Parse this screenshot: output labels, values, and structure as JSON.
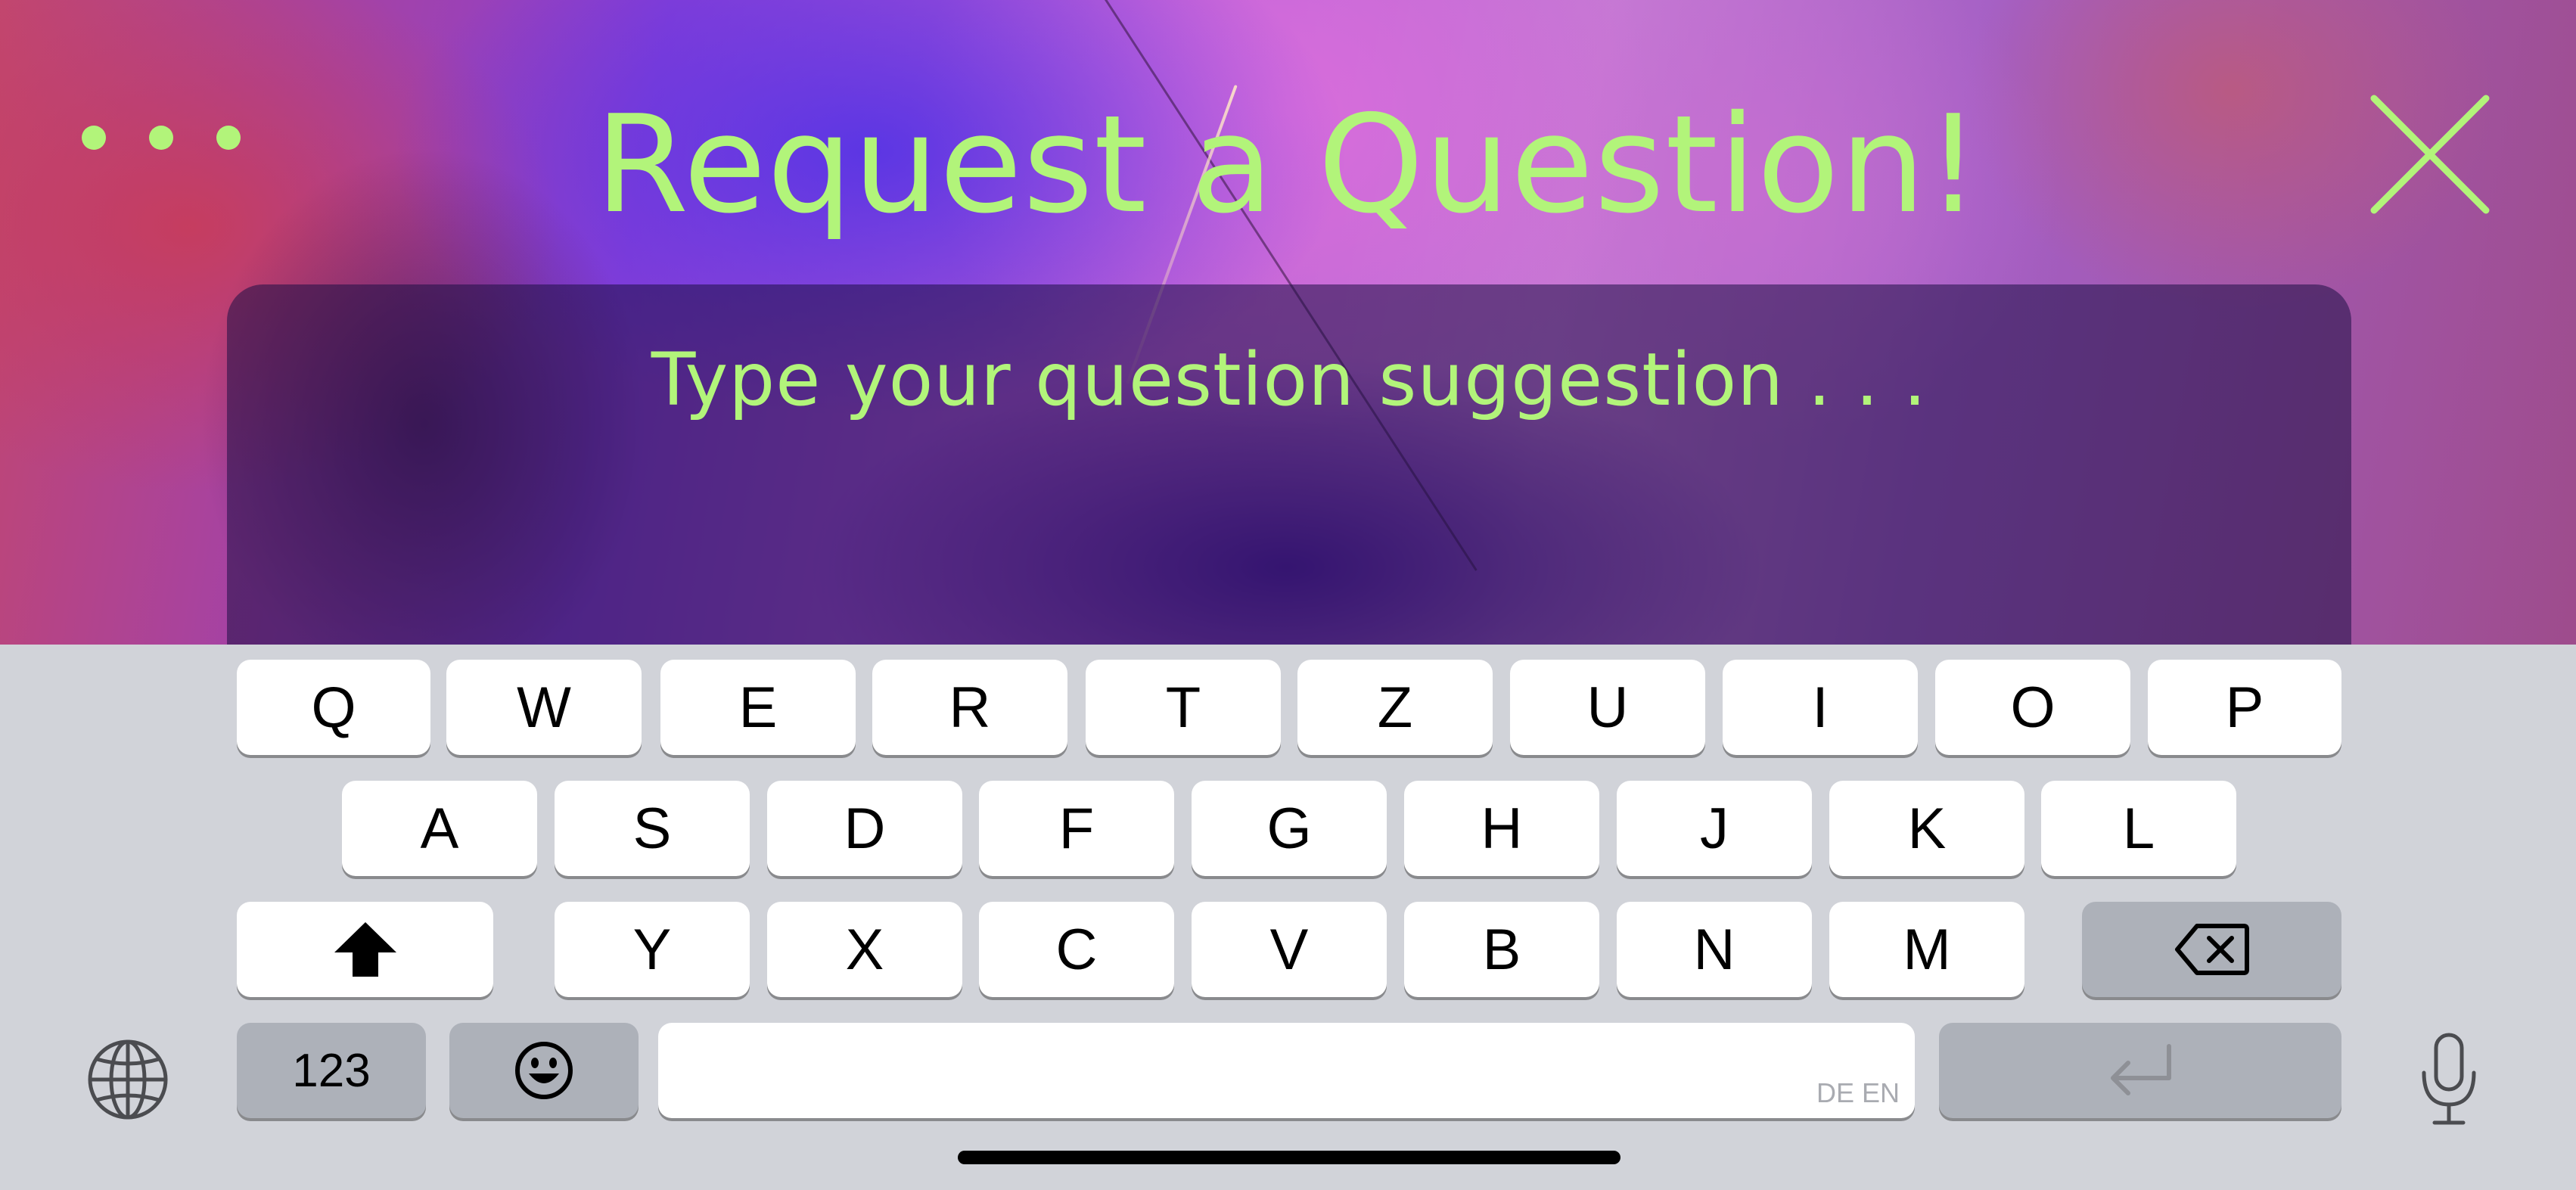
{
  "header": {
    "title": "Request a Question!",
    "more_icon": "more-dots-icon",
    "close_icon": "close-x-icon"
  },
  "input": {
    "placeholder": "Type your question suggestion . . ."
  },
  "keyboard": {
    "row1": [
      "Q",
      "W",
      "E",
      "R",
      "T",
      "Z",
      "U",
      "I",
      "O",
      "P"
    ],
    "row2": [
      "A",
      "S",
      "D",
      "F",
      "G",
      "H",
      "J",
      "K",
      "L"
    ],
    "row3": [
      "Y",
      "X",
      "C",
      "V",
      "B",
      "N",
      "M"
    ],
    "shift_icon": "shift-arrow-icon",
    "delete_icon": "delete-backspace-icon",
    "numbers_label": "123",
    "emoji_icon": "emoji-smiley-icon",
    "space_hint": "DE EN",
    "return_icon": "return-arrow-icon",
    "globe_icon": "globe-icon",
    "mic_icon": "microphone-icon"
  },
  "colors": {
    "accent": "#b2f47a",
    "keyboard_bg": "#d1d3d9",
    "key_bg": "#ffffff",
    "key_gray": "#adb1b9"
  }
}
